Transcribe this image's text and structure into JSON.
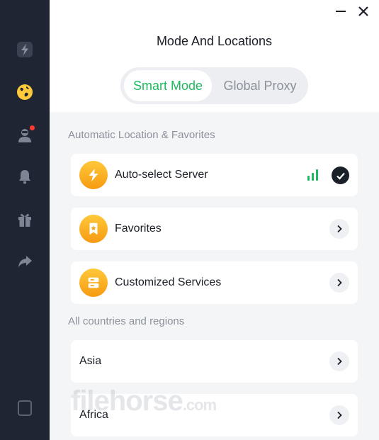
{
  "window": {
    "minimize_icon": "minimize-icon",
    "close_icon": "close-icon"
  },
  "sidebar": {
    "items": [
      {
        "id": "speed",
        "icon": "lightning-icon",
        "active": false
      },
      {
        "id": "locations",
        "icon": "globe-icon",
        "active": true
      },
      {
        "id": "account",
        "icon": "user-icon",
        "active": false,
        "badge": true
      },
      {
        "id": "notifications",
        "icon": "bell-icon",
        "active": false
      },
      {
        "id": "gifts",
        "icon": "gift-icon",
        "active": false
      },
      {
        "id": "share",
        "icon": "share-arrow-icon",
        "active": false
      },
      {
        "id": "devices",
        "icon": "device-icon",
        "active": false
      }
    ]
  },
  "header": {
    "title": "Mode And Locations"
  },
  "mode_toggle": {
    "smart": "Smart Mode",
    "global": "Global Proxy",
    "selected": "smart"
  },
  "sections": {
    "automatic": "Automatic Location & Favorites",
    "countries": "All countries and regions"
  },
  "auto_items": [
    {
      "label": "Auto-select Server",
      "icon": "lightning-icon",
      "selected": true,
      "signal": "strong"
    },
    {
      "label": "Favorites",
      "icon": "bookmark-icon"
    },
    {
      "label": "Customized Services",
      "icon": "server-icon"
    }
  ],
  "regions": [
    {
      "label": "Asia"
    },
    {
      "label": "Africa"
    }
  ],
  "watermark": {
    "text": "filehorse",
    "suffix": ".com"
  },
  "colors": {
    "accent": "#1dba5f",
    "sidebar": "#1f2533",
    "icon_gradient_top": "#ffc93a",
    "icon_gradient_bottom": "#f79a12"
  }
}
